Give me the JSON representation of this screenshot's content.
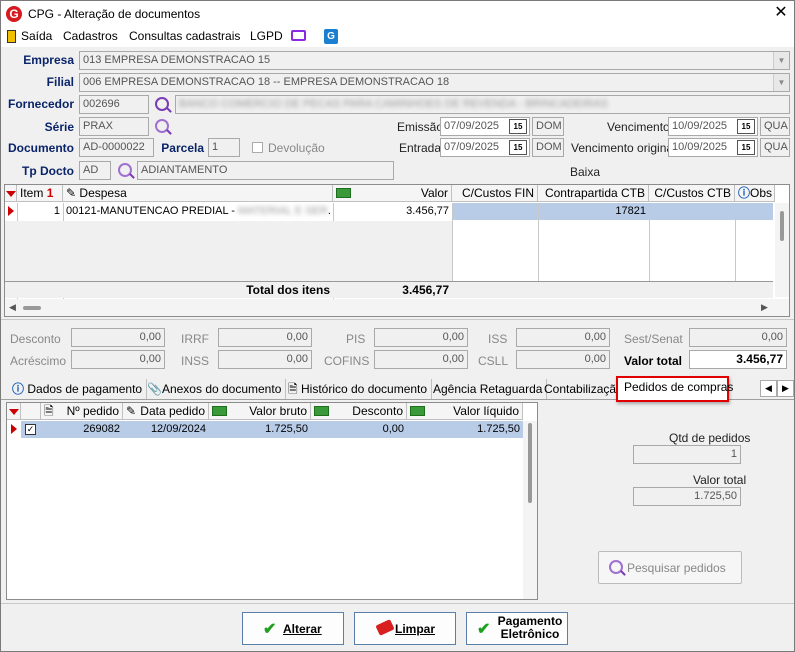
{
  "window": {
    "title": "CPG - Alteração de documentos",
    "app_icon": "G"
  },
  "menu": [
    "Saída",
    "Cadastros",
    "Consultas cadastrais",
    "LGPD"
  ],
  "form": {
    "empresa_label": "Empresa",
    "empresa_value": "013 EMPRESA DEMONSTRACAO 15",
    "filial_label": "Filial",
    "filial_value": "006 EMPRESA DEMONSTRACAO 18 -- EMPRESA DEMONSTRACAO 18",
    "fornecedor_label": "Fornecedor",
    "fornecedor_code": "002696",
    "fornecedor_name": "BANCO COMERCIO DE PECAS PARA CAMINHOES DE REVENDA - BRINCADEIRAS",
    "serie_label": "Série",
    "serie_value": "PRAX",
    "documento_label": "Documento",
    "documento_value": "AD-0000022",
    "parcela_label": "Parcela",
    "parcela_value": "1",
    "devolucao_label": "Devolução",
    "tpdocto_label": "Tp Docto",
    "tpdocto_code": "AD",
    "tpdocto_name": "ADIANTAMENTO",
    "emissao_label": "Emissão",
    "emissao_date": "07/09/2025",
    "emissao_day": "DOM",
    "entrada_label": "Entrada",
    "entrada_date": "07/09/2025",
    "entrada_day": "DOM",
    "vencimento_label": "Vencimento",
    "vencimento_date": "10/09/2025",
    "vencimento_day": "QUA",
    "venc_orig_label": "Vencimento original",
    "venc_orig_date": "10/09/2025",
    "venc_orig_day": "QUA",
    "baixa_label": "Baixa"
  },
  "items_grid": {
    "headers": [
      "Item",
      "Despesa",
      "Valor",
      "C/Custos FIN",
      "Contrapartida CTB",
      "C/Custos CTB",
      "Obs"
    ],
    "row": {
      "item": "1",
      "despesa": "00121-MANUTENCAO PREDIAL - ",
      "despesa_blur": "MATERIAL E SER",
      "despesa_tail": ".",
      "valor": "3.456,77",
      "contrapartida": "17821"
    },
    "total_label": "Total dos itens",
    "total_value": "3.456,77"
  },
  "totals": {
    "desconto_label": "Desconto",
    "desconto": "0,00",
    "irrf_label": "IRRF",
    "irrf": "0,00",
    "pis_label": "PIS",
    "pis": "0,00",
    "iss_label": "ISS",
    "iss": "0,00",
    "sest_label": "Sest/Senat",
    "sest": "0,00",
    "acrescimo_label": "Acréscimo",
    "acrescimo": "0,00",
    "inss_label": "INSS",
    "inss": "0,00",
    "cofins_label": "COFINS",
    "cofins": "0,00",
    "csll_label": "CSLL",
    "csll": "0,00",
    "valor_total_label": "Valor total",
    "valor_total": "3.456,77"
  },
  "tabs": [
    "Dados de pagamento",
    "Anexos do documento",
    "Histórico do documento",
    "Agência Retaguarda",
    "Contabilização",
    "Pedidos de compras"
  ],
  "orders_grid": {
    "headers": [
      "Nº pedido",
      "Data pedido",
      "Valor bruto",
      "Desconto",
      "Valor líquido"
    ],
    "row": {
      "numero": "269082",
      "data": "12/09/2024",
      "bruto": "1.725,50",
      "desconto": "0,00",
      "liquido": "1.725,50"
    }
  },
  "side": {
    "qtd_label": "Qtd de pedidos",
    "qtd_value": "1",
    "valor_label": "Valor total",
    "valor_value": "1.725,50",
    "pesquisar_label": "Pesquisar pedidos"
  },
  "buttons": {
    "alterar": "Alterar",
    "limpar": "Limpar",
    "pagamento1": "Pagamento",
    "pagamento2": "Eletrônico"
  },
  "colors": {
    "accent": "#d71920",
    "selection": "#b8cce8",
    "highlight_border": "#e00000"
  }
}
